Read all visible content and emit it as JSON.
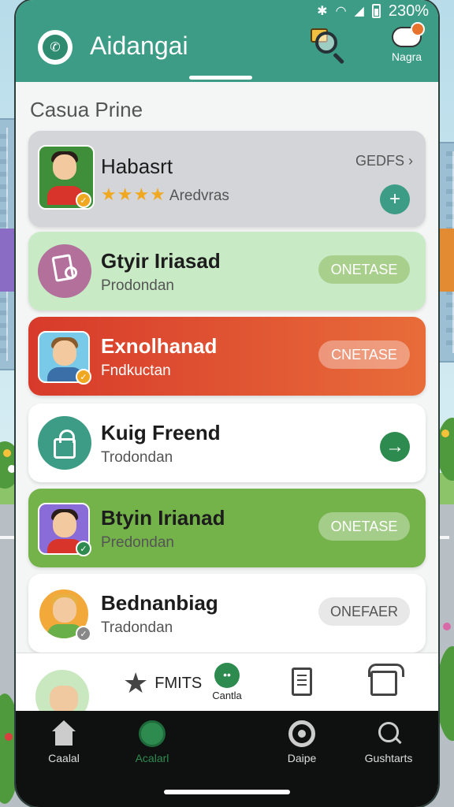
{
  "status_bar": {
    "battery": "230%",
    "icons": [
      "bluetooth-icon",
      "wifi-icon",
      "signal-icon",
      "battery-icon"
    ]
  },
  "app_bar": {
    "title": "Aidangai",
    "profile_label": "Nagra"
  },
  "section_title": "Casua Prine",
  "cards": [
    {
      "name": "Habasrt",
      "rating_text": "Aredvras",
      "stars": 4,
      "link_label": "GEDFS",
      "action": "+"
    },
    {
      "name": "Gtyir Iriasad",
      "subtitle": "Prodondan",
      "button": "ONETASE"
    },
    {
      "name": "Exnolhanad",
      "subtitle": "Fndkuctan",
      "button": "CNETASE"
    },
    {
      "name": "Kuig Freend",
      "subtitle": "Trodondan",
      "action": "→"
    },
    {
      "name": "Btyin Irianad",
      "subtitle": "Predondan",
      "button": "ONETASE"
    },
    {
      "name": "Bednanbiag",
      "subtitle": "Tradondan",
      "button": "ONEFAER"
    }
  ],
  "shortcut_bar": {
    "mits_label": "FMITS",
    "cantla_label": "Cantla"
  },
  "bottom_nav": [
    {
      "label": "Caalal",
      "icon": "home-icon",
      "active": false
    },
    {
      "label": "Acalarl",
      "icon": "globe-icon",
      "active": true
    },
    {
      "label": "Daipe",
      "icon": "camera-icon",
      "active": false
    },
    {
      "label": "Gushtarts",
      "icon": "search-icon",
      "active": false
    }
  ],
  "colors": {
    "primary": "#3c9c86",
    "card_red": "#d73a2a",
    "card_green": "#74b24a",
    "card_mint": "#c8ebc6"
  }
}
